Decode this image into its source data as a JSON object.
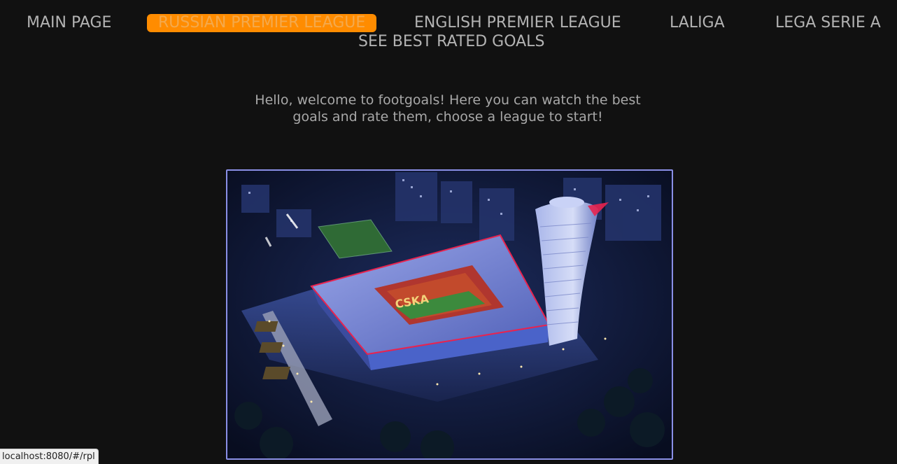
{
  "nav": {
    "main_page": "MAIN PAGE",
    "rpl": "RUSSIAN PREMIER LEAGUE",
    "epl": "ENGLISH PREMIER LEAGUE",
    "laliga": "LALIGA",
    "serie_a": "LEGA SERIE A",
    "best_goals": "SEE BEST RATED GOALS"
  },
  "welcome": {
    "line1": "Hello, welcome to footgoals! Here you can watch the best",
    "line2": "goals and rate them, choose a league to start!"
  },
  "hero": {
    "stadium_sign": "CSKA"
  },
  "status_bar": {
    "url": "localhost:8080/#/rpl"
  },
  "colors": {
    "background": "#111111",
    "accent": "#ff8c00",
    "hero_border": "#8a8fe6",
    "nav_text": "#b3b3b3"
  }
}
